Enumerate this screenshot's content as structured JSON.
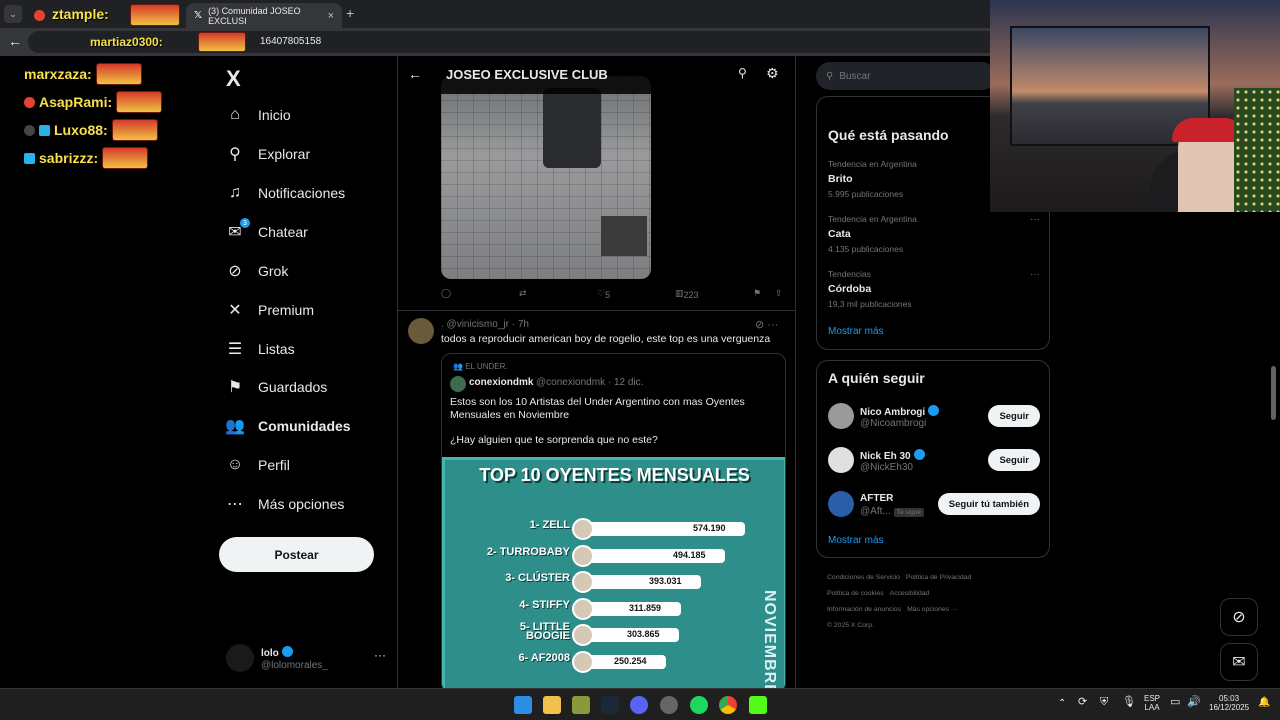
{
  "browser": {
    "tab_title": "(3) Comunidad JOSEO EXCLUSI",
    "tab_close": "×",
    "new_tab": "+",
    "url_partial": "16407805158"
  },
  "overlay": {
    "top_names": [
      "ztample:",
      "martiaz0300:"
    ],
    "chat": [
      {
        "name": "marxzaza:",
        "color": "#f7e04b"
      },
      {
        "name": "AsapRami:",
        "color": "#f7e04b"
      },
      {
        "name": "Luxo88:",
        "color": "#f7e04b"
      },
      {
        "name": "sabrizzz:",
        "color": "#f7e04b"
      }
    ]
  },
  "nav": {
    "logo": "X",
    "items": [
      {
        "label": "Inicio",
        "icon": "home-icon",
        "glyph": "⌂"
      },
      {
        "label": "Explorar",
        "icon": "search-icon",
        "glyph": "⚲"
      },
      {
        "label": "Notificaciones",
        "icon": "bell-icon",
        "glyph": "♫"
      },
      {
        "label": "Chatear",
        "icon": "mail-icon",
        "glyph": "✉"
      },
      {
        "label": "Grok",
        "icon": "grok-icon",
        "glyph": "⊘"
      },
      {
        "label": "Premium",
        "icon": "x-icon",
        "glyph": "✕"
      },
      {
        "label": "Listas",
        "icon": "list-icon",
        "glyph": "☰"
      },
      {
        "label": "Guardados",
        "icon": "bookmark-icon",
        "glyph": "⚑"
      },
      {
        "label": "Comunidades",
        "icon": "communities-icon",
        "glyph": "👥"
      },
      {
        "label": "Perfil",
        "icon": "profile-icon",
        "glyph": "☺"
      },
      {
        "label": "Más opciones",
        "icon": "more-icon",
        "glyph": "⋯"
      }
    ],
    "chat_badge": "3",
    "post_button": "Postear",
    "account": {
      "name": "lolo",
      "handle": "@lolomorales_",
      "more": "···"
    }
  },
  "main": {
    "header_title": "JOSEO EXCLUSIVE CLUB",
    "post1_actions": {
      "likes": "5",
      "views": "223"
    },
    "post2": {
      "meta": ". @vinicismo_jr · 7h",
      "text": "todos a reproducir american boy de rogelio, este top es una verguenza",
      "more": "···"
    },
    "quote": {
      "community": "EL UNDER.",
      "name": "conexiondmk",
      "handle": "@conexiondmk · 12 dic.",
      "text": "Estos son los 10 Artistas del Under Argentino con mas Oyentes Mensuales en Noviembre",
      "text2": "¿Hay alguien que te sorprenda que no este?"
    }
  },
  "chart_data": {
    "type": "bar",
    "title": "TOP 10 OYENTES MENSUALES",
    "side_label": "NOVIEMBRE",
    "categories": [
      "1- ZELL",
      "2- TURROBABY",
      "3- CLÚSTER",
      "4- STIFFY",
      "5- LITTLE BOOGIE",
      "6- AF2008"
    ],
    "value_labels": [
      "574.190",
      "494.185",
      "393.031",
      "311.859",
      "303.865",
      "250.254"
    ],
    "values": [
      574190,
      494185,
      393031,
      311859,
      303865,
      250254
    ],
    "colors": {
      "background": "#2e8e8a",
      "bar": "#ffffff"
    }
  },
  "right": {
    "search_placeholder": "Buscar",
    "trends_title": "Qué está pasando",
    "trends": [
      {
        "context": "Tendencia en Argentina",
        "name": "Brito",
        "count": "5.995 publicaciones"
      },
      {
        "context": "Tendencia en Argentina",
        "name": "Cata",
        "count": "4.135 publicaciones"
      },
      {
        "context": "Tendencias",
        "name": "Córdoba",
        "count": "19,3 mil publicaciones"
      }
    ],
    "show_more": "Mostrar más",
    "follow_title": "A quién seguir",
    "follow": [
      {
        "name": "Nico Ambrogi",
        "handle": "@Nicoambrogi",
        "button": "Seguir"
      },
      {
        "name": "Nick Eh 30",
        "handle": "@NickEh30",
        "button": "Seguir"
      },
      {
        "name": "AFTER",
        "handle": "@Aft...",
        "badge": "Te sigue",
        "button": "Seguir tú también"
      }
    ],
    "footer": [
      "Condiciones de Servicio",
      "Política de Privacidad",
      "Política de cookies",
      "Accesibilidad",
      "Información de anuncios",
      "Más opciones ···",
      "© 2025 X Corp."
    ]
  },
  "taskbar": {
    "lang": "ESP",
    "lang2": "LAA",
    "time": "05:03",
    "date": "16/12/2025"
  }
}
